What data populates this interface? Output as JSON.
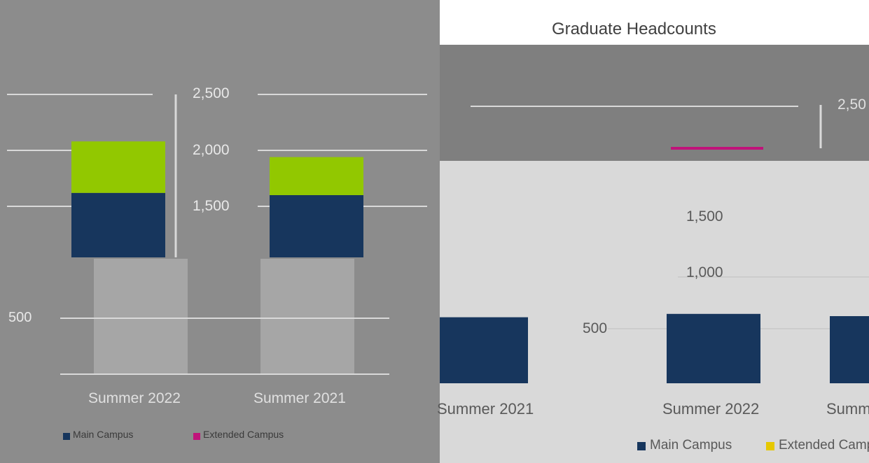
{
  "colors": {
    "main_campus": "#17365d",
    "extended_campus": "#92c800",
    "extended_campus_alt": "#e6c800",
    "online": "#c0137a",
    "grid": "#d9d9d9",
    "left_panel_bg": "#8c8c8c",
    "right_panel_bg": "#d9d9d9",
    "ghost_bar": "#a6a6a6"
  },
  "left_panel": {
    "ticks": [
      "2,500",
      "2,000",
      "1,500",
      "500"
    ],
    "category_labels": [
      "Summer 2022",
      "Summer 2021"
    ],
    "legend": [
      "Main Campus",
      "Extended Campus"
    ]
  },
  "right_panel": {
    "title": "Graduate Headcounts",
    "ticks": [
      "2,50",
      "1,500",
      "1,000",
      "500"
    ],
    "category_labels": [
      "Summer 2021",
      "Summer 2022",
      "Summ"
    ],
    "legend": [
      "Main Campus",
      "Extended Campus"
    ]
  },
  "chart_data": [
    {
      "type": "bar",
      "stacked": true,
      "categories": [
        "Summer 2022",
        "Summer 2021"
      ],
      "series": [
        {
          "name": "Main Campus",
          "values": [
            1620,
            1600
          ]
        },
        {
          "name": "Extended Campus",
          "values": [
            460,
            340
          ]
        }
      ],
      "ylim": [
        0,
        2500
      ],
      "grid": true,
      "legend": "bottom"
    },
    {
      "type": "bar",
      "title": "Graduate Headcounts",
      "categories": [
        "Summer 2021",
        "Summer 2022",
        "Summ"
      ],
      "series": [
        {
          "name": "Main Campus",
          "values": [
            590,
            620,
            600
          ]
        }
      ],
      "ylim": [
        0,
        2500
      ],
      "grid": true,
      "legend": "bottom"
    }
  ]
}
